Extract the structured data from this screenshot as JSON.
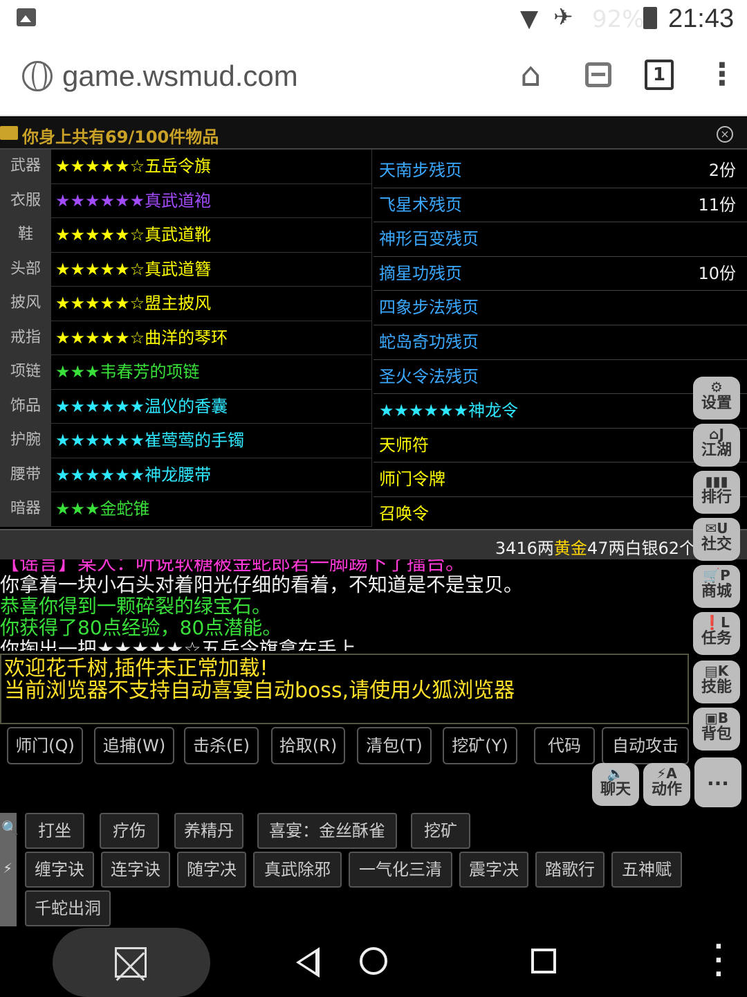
{
  "status_bar": {
    "battery": "92%",
    "time": "21:43"
  },
  "browser": {
    "url": "game.wsmud.com",
    "tab_count": "1"
  },
  "inventory": {
    "title": "你身上共有69/100件物品",
    "equipment": [
      {
        "slot": "武器",
        "name": "★★★★★☆五岳令旗",
        "color": "#ffff00"
      },
      {
        "slot": "衣服",
        "name": "★★★★★★真武道袍",
        "color": "#a34cff"
      },
      {
        "slot": "鞋",
        "name": "★★★★★☆真武道靴",
        "color": "#ffff00"
      },
      {
        "slot": "头部",
        "name": "★★★★★☆真武道簪",
        "color": "#ffff00"
      },
      {
        "slot": "披风",
        "name": "★★★★★☆盟主披风",
        "color": "#ffff00"
      },
      {
        "slot": "戒指",
        "name": "★★★★★☆曲洋的琴环",
        "color": "#ffff00"
      },
      {
        "slot": "项链",
        "name": "★★★韦春芳的项链",
        "color": "#39e03a"
      },
      {
        "slot": "饰品",
        "name": "★★★★★★温仪的香囊",
        "color": "#2ee8ff"
      },
      {
        "slot": "护腕",
        "name": "★★★★★★崔莺莺的手镯",
        "color": "#2ee8ff"
      },
      {
        "slot": "腰带",
        "name": "★★★★★★神龙腰带",
        "color": "#2ee8ff"
      },
      {
        "slot": "暗器",
        "name": "★★★金蛇锥",
        "color": "#39e03a"
      }
    ],
    "items": [
      {
        "name": "天南步残页",
        "count": "2份",
        "color": "#3aa8ff"
      },
      {
        "name": "飞星术残页",
        "count": "11份",
        "color": "#3aa8ff"
      },
      {
        "name": "神形百变残页",
        "count": "",
        "color": "#3aa8ff"
      },
      {
        "name": "摘星功残页",
        "count": "10份",
        "color": "#3aa8ff"
      },
      {
        "name": "四象步法残页",
        "count": "",
        "color": "#3aa8ff"
      },
      {
        "name": "蛇岛奇功残页",
        "count": "",
        "color": "#3aa8ff"
      },
      {
        "name": "圣火令法残页",
        "count": "",
        "color": "#3aa8ff"
      },
      {
        "name": "★★★★★★神龙令",
        "count": "",
        "color": "#2ee8ff"
      },
      {
        "name": "天师符",
        "count": "",
        "color": "#ffff00"
      },
      {
        "name": "师门令牌",
        "count": "",
        "color": "#ffff00"
      },
      {
        "name": "召唤令",
        "count": "",
        "color": "#ffff00"
      }
    ],
    "money_prefix": "3416两",
    "money_gold": "黄金",
    "money_suffix": "47两白银62个"
  },
  "log": [
    "【谣言】某人：听说软糖被金蛇郎君一脚踢下了擂台。",
    "你拿着一块小石头对着阳光仔细的看着，不知道是不是宝贝。",
    "恭喜你得到一颗碎裂的绿宝石。",
    "你获得了80点经验，80点潜能。",
    "你掏出一把★★★★★☆五岳令旗拿在手上。"
  ],
  "notice": [
    "欢迎花千树,插件未正常加载!",
    "当前浏览器不支持自动喜宴自动boss,请使用火狐浏览器"
  ],
  "game_buttons": [
    "师门(Q)",
    "追捕(W)",
    "击杀(E)",
    "拾取(R)",
    "清包(T)",
    "挖矿(Y)",
    "代码",
    "自动攻击"
  ],
  "side_menu": [
    {
      "key": "",
      "label": "设置",
      "icon": "gear-icon"
    },
    {
      "key": "J",
      "label": "江湖",
      "icon": "home-icon"
    },
    {
      "key": "",
      "label": "排行",
      "icon": "bar-chart-icon"
    },
    {
      "key": "U",
      "label": "社交",
      "icon": "mail-icon"
    },
    {
      "key": "P",
      "label": "商城",
      "icon": "cart-icon"
    },
    {
      "key": "L",
      "label": "任务",
      "icon": "alert-icon"
    },
    {
      "key": "K",
      "label": "技能",
      "icon": "book-icon"
    },
    {
      "key": "B",
      "label": "背包",
      "icon": "bag-icon"
    }
  ],
  "chat_button": "聊天",
  "action_button": {
    "key": "A",
    "label": "动作"
  },
  "more_button": "...",
  "quick_row1": [
    "打坐",
    "疗伤",
    "养精丹",
    "喜宴：金丝酥雀",
    "挖矿"
  ],
  "quick_row2": [
    "缠字诀",
    "连字诀",
    "随字决",
    "真武除邪",
    "一气化三清",
    "震字决",
    "踏歌行",
    "五神赋"
  ],
  "quick_row3": [
    "千蛇出洞"
  ],
  "colors": {
    "gold": "#ffd700",
    "notice": "#ffe12a",
    "rumor": "#ff3ad8",
    "green": "#39e03a",
    "blue": "#3aa8ff",
    "cyan": "#2ee8ff",
    "purple": "#a34cff"
  }
}
